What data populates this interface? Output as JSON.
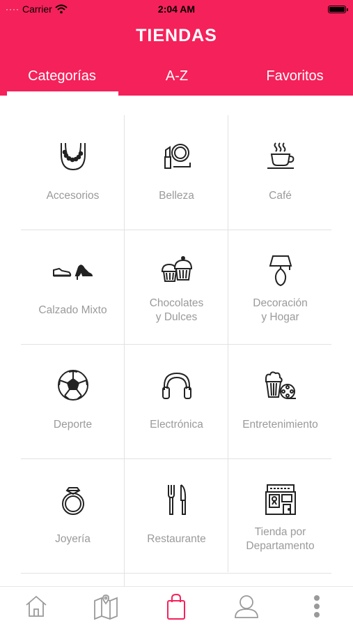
{
  "status_bar": {
    "carrier": "Carrier",
    "time": "2:04 AM"
  },
  "header": {
    "title": "TIENDAS",
    "tabs": [
      {
        "label": "Categorías",
        "selected": true
      },
      {
        "label": "A-Z",
        "selected": false
      },
      {
        "label": "Favoritos",
        "selected": false
      }
    ]
  },
  "categories": [
    {
      "line1": "Accesorios",
      "line2": "",
      "icon": "necklace-icon"
    },
    {
      "line1": "Belleza",
      "line2": "",
      "icon": "lipstick-mirror-icon"
    },
    {
      "line1": "Café",
      "line2": "",
      "icon": "coffee-cup-icon"
    },
    {
      "line1": "Calzado Mixto",
      "line2": "",
      "icon": "shoes-icon"
    },
    {
      "line1": "Chocolates",
      "line2": "y Dulces",
      "icon": "cupcakes-icon"
    },
    {
      "line1": "Decoración",
      "line2": "y Hogar",
      "icon": "lamp-icon"
    },
    {
      "line1": "Deporte",
      "line2": "",
      "icon": "soccer-ball-icon"
    },
    {
      "line1": "Electrónica",
      "line2": "",
      "icon": "headphones-icon"
    },
    {
      "line1": "Entretenimiento",
      "line2": "",
      "icon": "popcorn-film-icon"
    },
    {
      "line1": "Joyería",
      "line2": "",
      "icon": "ring-icon"
    },
    {
      "line1": "Restaurante",
      "line2": "",
      "icon": "fork-knife-icon"
    },
    {
      "line1": "Tienda por",
      "line2": "Departamento",
      "icon": "department-store-icon"
    }
  ],
  "tab_bar": [
    {
      "icon": "home-icon",
      "selected": false
    },
    {
      "icon": "map-icon",
      "selected": false
    },
    {
      "icon": "shopping-bag-icon",
      "selected": true
    },
    {
      "icon": "profile-icon",
      "selected": false
    },
    {
      "icon": "more-icon",
      "selected": false
    }
  ],
  "colors": {
    "brand": "#f5215a",
    "label_gray": "#9a9a9a",
    "icon_dark": "#222222",
    "tab_inactive": "#9a9a9a"
  }
}
